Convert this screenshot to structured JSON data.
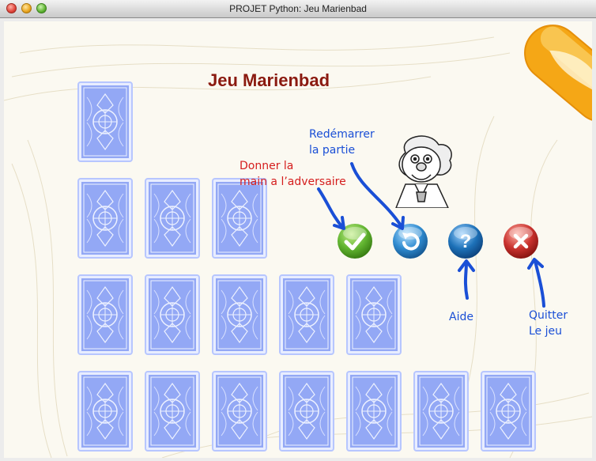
{
  "window": {
    "title": "PROJET Python: Jeu Marienbad"
  },
  "game": {
    "heading": "Jeu Marienbad",
    "rows": [
      1,
      3,
      5,
      7
    ]
  },
  "buttons": {
    "validate": "validate",
    "restart": "restart",
    "help": "help",
    "quit": "quit"
  },
  "notes": {
    "give_hand": [
      "Donner la",
      "main a l’adversaire"
    ],
    "restart": [
      "Redémarrer",
      "la partie"
    ],
    "help": [
      "Aide"
    ],
    "quit": [
      "Quitter",
      "Le jeu"
    ]
  },
  "colors": {
    "card_fill": "#93a8f5",
    "card_border": "#b7c6ff",
    "heading": "#8b1a10",
    "validate": "#62b531",
    "restart": "#2f8bd0",
    "help": "#1d71b8",
    "quit": "#c9322e",
    "annotation_blue": "#1a4fd6",
    "annotation_red": "#d51e1e"
  },
  "icons": [
    "checkmark-icon",
    "restart-icon",
    "question-mark-icon",
    "close-x-icon",
    "professor-illustration",
    "feather-logo"
  ]
}
